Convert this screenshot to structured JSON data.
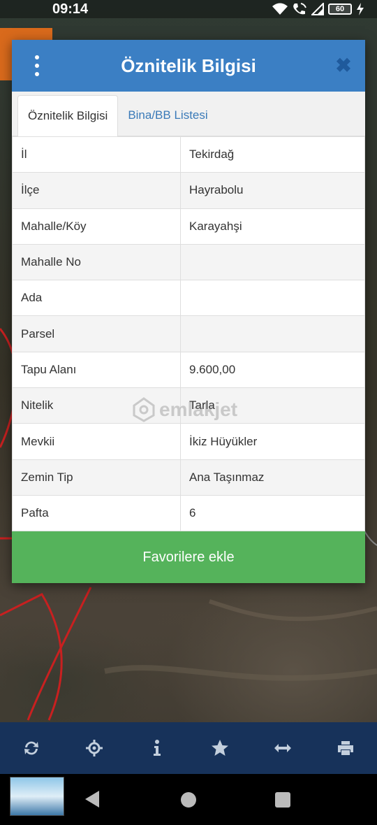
{
  "status_bar": {
    "time": "09:14",
    "battery": "60"
  },
  "dialog": {
    "title": "Öznitelik Bilgisi",
    "tabs": [
      {
        "label": "Öznitelik Bilgisi",
        "active": true
      },
      {
        "label": "Bina/BB Listesi",
        "active": false
      }
    ],
    "rows": [
      {
        "key": "İl",
        "value": "Tekirdağ"
      },
      {
        "key": "İlçe",
        "value": "Hayrabolu"
      },
      {
        "key": "Mahalle/Köy",
        "value": "Karayahşi"
      },
      {
        "key": "Mahalle No",
        "value": ""
      },
      {
        "key": "Ada",
        "value": ""
      },
      {
        "key": "Parsel",
        "value": ""
      },
      {
        "key": "Tapu Alanı",
        "value": "9.600,00"
      },
      {
        "key": "Nitelik",
        "value": "Tarla"
      },
      {
        "key": "Mevkii",
        "value": "İkiz Hüyükler"
      },
      {
        "key": "Zemin Tip",
        "value": "Ana Taşınmaz"
      },
      {
        "key": "Pafta",
        "value": "6"
      }
    ],
    "favorite_label": "Favorilere ekle"
  },
  "watermark": "emlakjet",
  "toolbar": {
    "icons": [
      "refresh-icon",
      "locate-icon",
      "info-icon",
      "star-icon",
      "measure-icon",
      "print-icon"
    ]
  },
  "colors": {
    "header": "#3b7fc4",
    "favorite_button": "#55b35b",
    "toolbar": "#17325a",
    "tab_inactive_text": "#3a7ab8"
  }
}
